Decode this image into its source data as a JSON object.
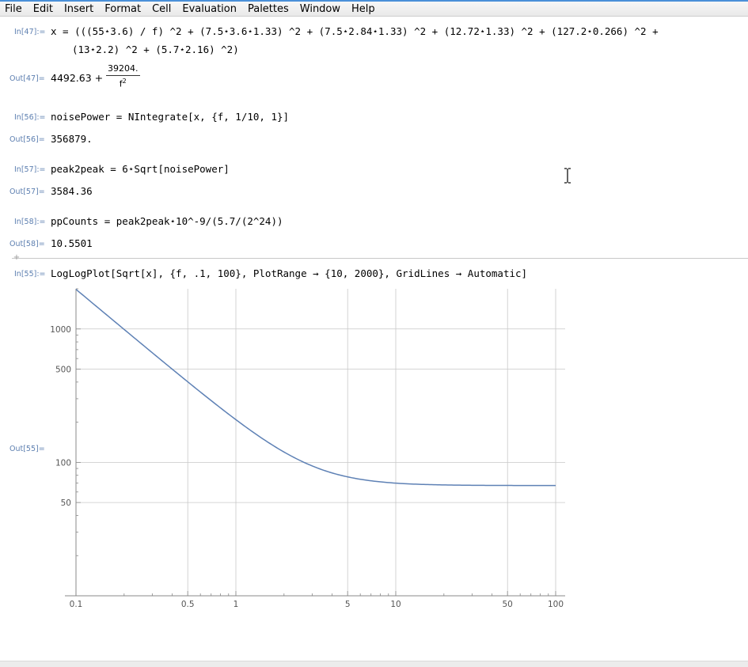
{
  "menu": [
    "File",
    "Edit",
    "Insert",
    "Format",
    "Cell",
    "Evaluation",
    "Palettes",
    "Window",
    "Help"
  ],
  "cells": {
    "in47": {
      "label": "In[47]:=",
      "line1": "x = (((55⋆3.6) / f) ^2 + (7.5⋆3.6⋆1.33) ^2 + (7.5⋆2.84⋆1.33) ^2 + (12.72⋆1.33) ^2 + (127.2⋆0.266) ^2 +",
      "line2": "(13⋆2.2) ^2 + (5.7⋆2.16) ^2)"
    },
    "out47": {
      "label": "Out[47]=",
      "lead": "4492.63 + ",
      "numerator": "39204.",
      "denominator": "f",
      "exponent": "2"
    },
    "in56": {
      "label": "In[56]:=",
      "text": "noisePower = NIntegrate[x, {f, 1/10, 1}]"
    },
    "out56": {
      "label": "Out[56]=",
      "text": "356879."
    },
    "in57": {
      "label": "In[57]:=",
      "text": "peak2peak = 6⋆Sqrt[noisePower]"
    },
    "out57": {
      "label": "Out[57]=",
      "text": "3584.36"
    },
    "in58": {
      "label": "In[58]:=",
      "text": "ppCounts = peak2peak⋆10^-9/(5.7/(2^24))"
    },
    "out58": {
      "label": "Out[58]=",
      "text": "10.5501"
    },
    "in55": {
      "label": "In[55]:=",
      "text": "LogLogPlot[Sqrt[x], {f, .1, 100}, PlotRange → {10, 2000}, GridLines → Automatic]"
    },
    "out55": {
      "label": "Out[55]="
    }
  },
  "colors": {
    "label": "#5d7fb0",
    "curve": "#5e81b5",
    "grid": "#c8c8c8",
    "menubar_accent": "#4a90d9"
  },
  "chart_data": {
    "type": "line",
    "xscale": "log",
    "yscale": "log",
    "xlim": [
      0.1,
      100
    ],
    "ylim": [
      10,
      2000
    ],
    "grid": true,
    "xticks": [
      0.1,
      0.5,
      1,
      5,
      10,
      50,
      100
    ],
    "xtick_labels": [
      "0.1",
      "0.5",
      "1",
      "5",
      "10",
      "50",
      "100"
    ],
    "yticks": [
      50,
      100,
      500,
      1000
    ],
    "ytick_labels": [
      "50",
      "100",
      "500",
      "1000"
    ],
    "function": "sqrt(4492.63 + 39204/f^2)",
    "series": [
      {
        "x": [
          0.1,
          0.15,
          0.2,
          0.3,
          0.5,
          0.7,
          1,
          1.5,
          2,
          3,
          5,
          7,
          10,
          20,
          50,
          100
        ],
        "values": [
          1981,
          1322,
          993,
          665,
          404,
          294,
          209,
          153,
          127,
          97.6,
          79.1,
          73.0,
          70.0,
          67.6,
          67.1,
          67.03
        ]
      }
    ]
  }
}
